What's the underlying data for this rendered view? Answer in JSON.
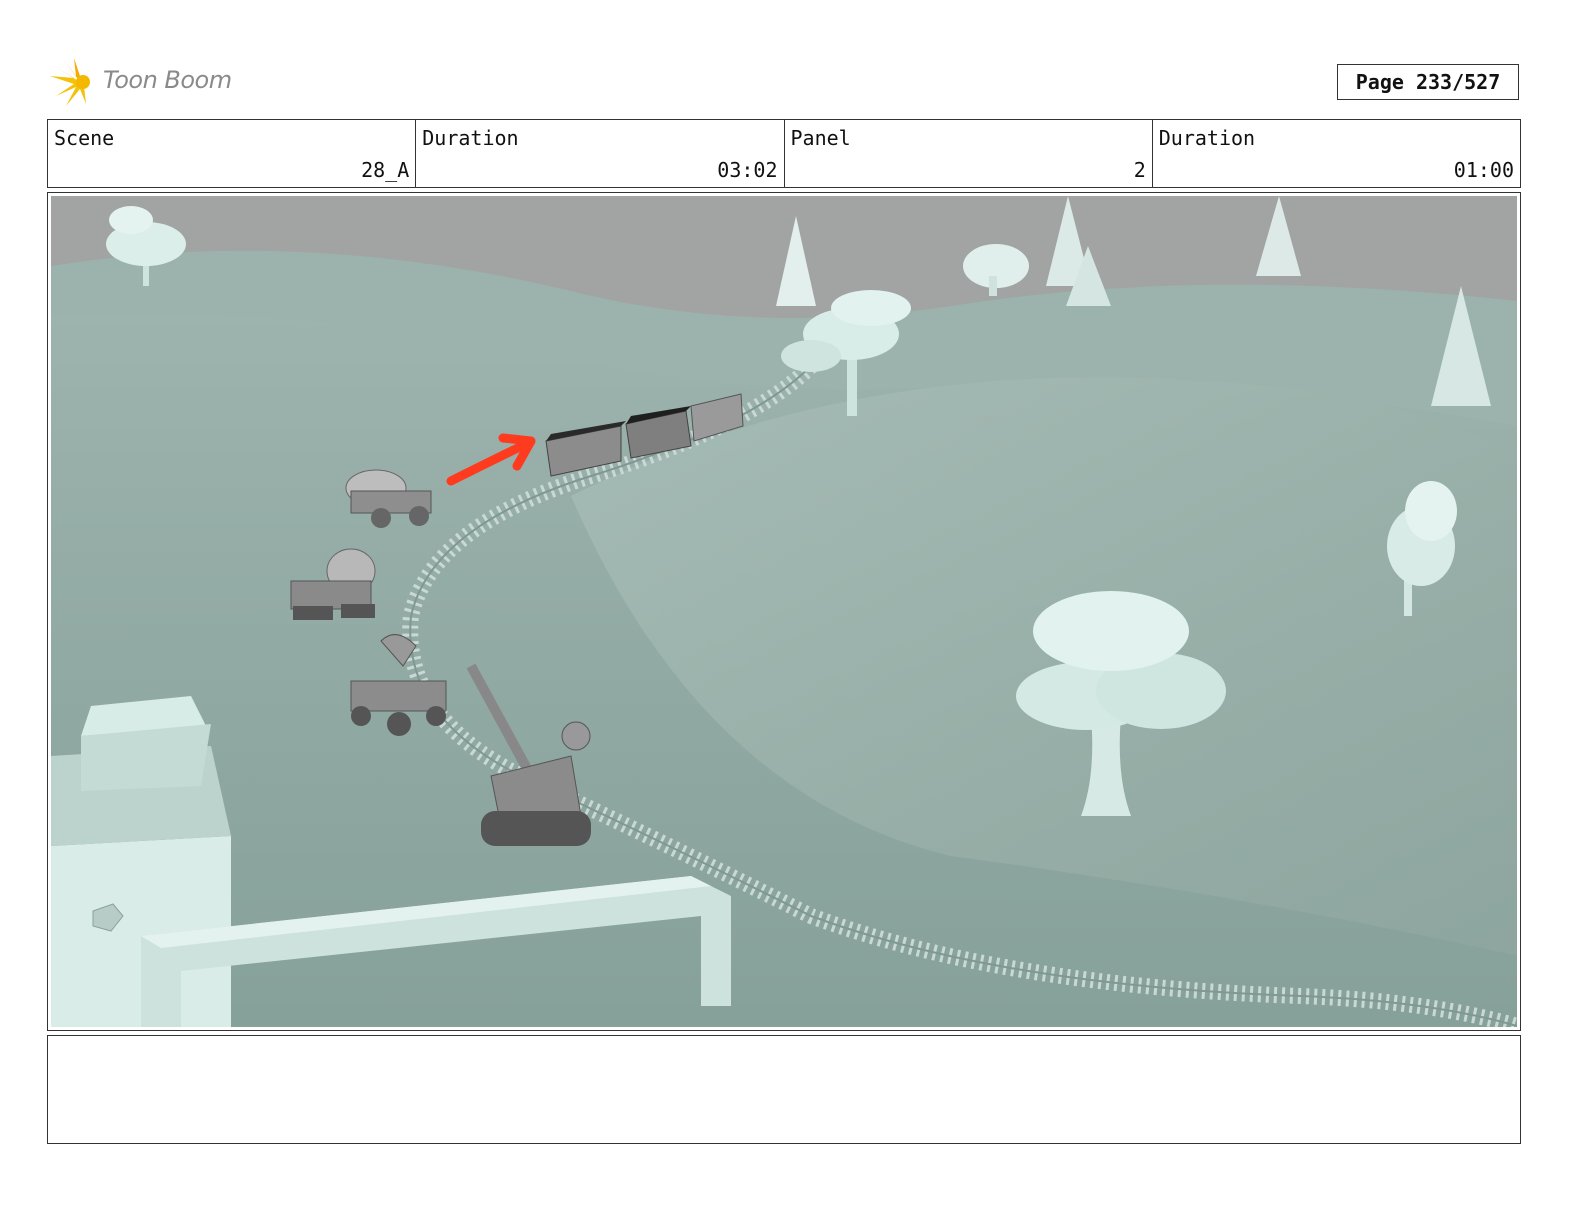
{
  "header": {
    "logo_text": "Toon Boom",
    "page_label": "Page 233/527"
  },
  "info": {
    "scene_label": "Scene",
    "scene_value": "28_A",
    "scene_duration_label": "Duration",
    "scene_duration_value": "03:02",
    "panel_label": "Panel",
    "panel_value": "2",
    "panel_duration_label": "Duration",
    "panel_duration_value": "01:00"
  },
  "panel_image": {
    "arrow_color": "#ff3b1f",
    "sky_color": "#a2a3a3",
    "terrain_color": "#8fa8a2"
  },
  "notes": {
    "text": ""
  }
}
